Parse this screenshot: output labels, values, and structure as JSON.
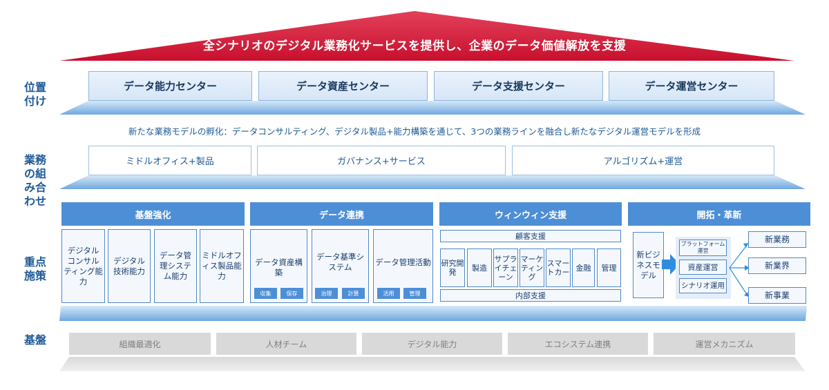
{
  "roof": {
    "title": "全シナリオのデジタル業務化サービスを提供し、企業のデータ価値解放を支援"
  },
  "side_labels": {
    "positioning": "位置付け",
    "combination": "業務の組み合わせ",
    "key_measures": "重点施策",
    "foundation": "基盤"
  },
  "centers": [
    "データ能力センター",
    "データ資産センター",
    "データ支援センター",
    "データ運営センター"
  ],
  "intro": "新たな業務モデルの孵化：データコンサルティング、デジタル製品+能力構築を通じて、3つの業務ラインを融合し新たなデジタル運営モデルを形成",
  "business_models": [
    "ミドルオフィス+製品",
    "ガバナンス+サービス",
    "アルゴリズム+運営"
  ],
  "columns": {
    "c1": {
      "title": "基盤強化",
      "cards": [
        "デジタルコンサルティング能力",
        "デジタル技術能力",
        "データ管理システム能力",
        "ミドルオフィス製品能力"
      ]
    },
    "c2": {
      "title": "データ連携",
      "cards": [
        {
          "label": "データ資産構築",
          "tags": [
            "収集",
            "保存"
          ]
        },
        {
          "label": "データ基準システム",
          "tags": [
            "治理",
            "計算"
          ]
        },
        {
          "label": "データ管理活動",
          "tags": [
            "活用",
            "管理"
          ]
        }
      ]
    },
    "c3": {
      "title": "ウィンウィン支援",
      "top": "顧客支援",
      "items": [
        "研究開発",
        "製造",
        "サプライチェーン",
        "マーケティング",
        "スマートカー",
        "金融",
        "管理"
      ],
      "bottom": "内部支援"
    },
    "c4": {
      "title": "開拓・革新",
      "left": "新ビジネスモデル",
      "mid": [
        "プラットフォーム運営",
        "資産運営",
        "シナリオ運用"
      ],
      "right": [
        "新業務",
        "新業界",
        "新事業"
      ]
    }
  },
  "foundation": [
    "組織最適化",
    "人材チーム",
    "デジタル能力",
    "エコシステム連携",
    "運営メカニズム"
  ],
  "colors": {
    "roof": "#d9304a",
    "accent": "#4d8fd6",
    "label": "#1f5a96",
    "foundation": "#d9d9d9"
  }
}
